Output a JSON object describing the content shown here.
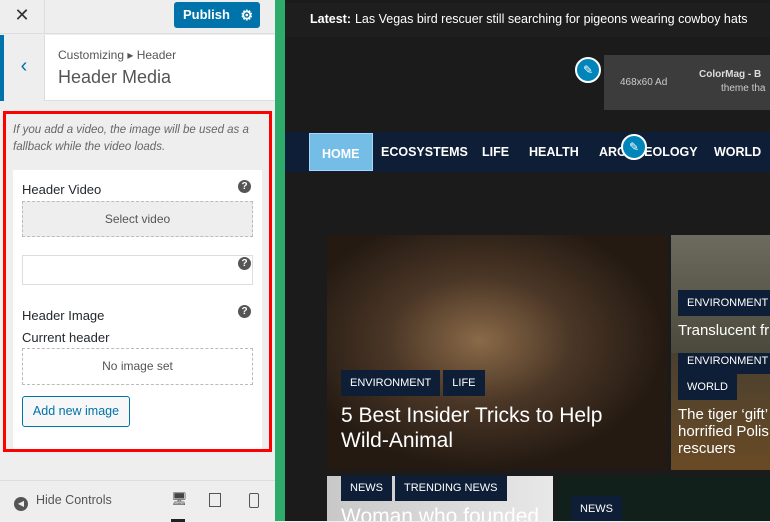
{
  "sidebar": {
    "close_label": "✕",
    "publish_label": "Publish",
    "gear_icon": "gear-icon",
    "back_icon": "chevron-left-icon",
    "breadcrumb": "Customizing ▸ Header",
    "section_title": "Header Media",
    "description": "If you add a video, the image will be used as a fallback while the video loads.",
    "header_video_label": "Header Video",
    "select_video_label": "Select video",
    "video_url_value": "",
    "header_image_label": "Header Image",
    "current_header_label": "Current header",
    "no_image_label": "No image set",
    "add_image_label": "Add new image",
    "hide_controls_label": "Hide Controls",
    "help_glyph": "?",
    "accent_color": "#0073aa",
    "highlight_color": "#ff0000"
  },
  "preview": {
    "ticker_label": "Latest:",
    "ticker_text": "Las Vegas bird rescuer still searching for pigeons wearing cowboy hats",
    "ad_size": "468x60 Ad",
    "ad_title": "ColorMag - B",
    "ad_sub": "theme tha",
    "nav": [
      "HOME",
      "ECOSYSTEMS",
      "LIFE",
      "HEALTH",
      "ARCHAEOLOGY",
      "WORLD"
    ],
    "main_card": {
      "tags": [
        "ENVIRONMENT",
        "LIFE"
      ],
      "title": "5 Best Insider Tricks to Help Wild-Animal"
    },
    "side_card_1": {
      "tags": [
        "ENVIRONMENT"
      ],
      "title": "Translucent fr"
    },
    "side_card_2": {
      "tags": [
        "ENVIRONMENT",
        "WORLD"
      ],
      "title": "The tiger ‘gift’ horrified Polis rescuers"
    },
    "bottom_card_1": {
      "tags": [
        "NEWS",
        "TRENDING NEWS"
      ],
      "title": "Woman who founded"
    },
    "bottom_card_2": {
      "tags": [
        "NEWS"
      ]
    },
    "frame_color": "#2eaa6b",
    "nav_active_color": "#73bde6"
  }
}
